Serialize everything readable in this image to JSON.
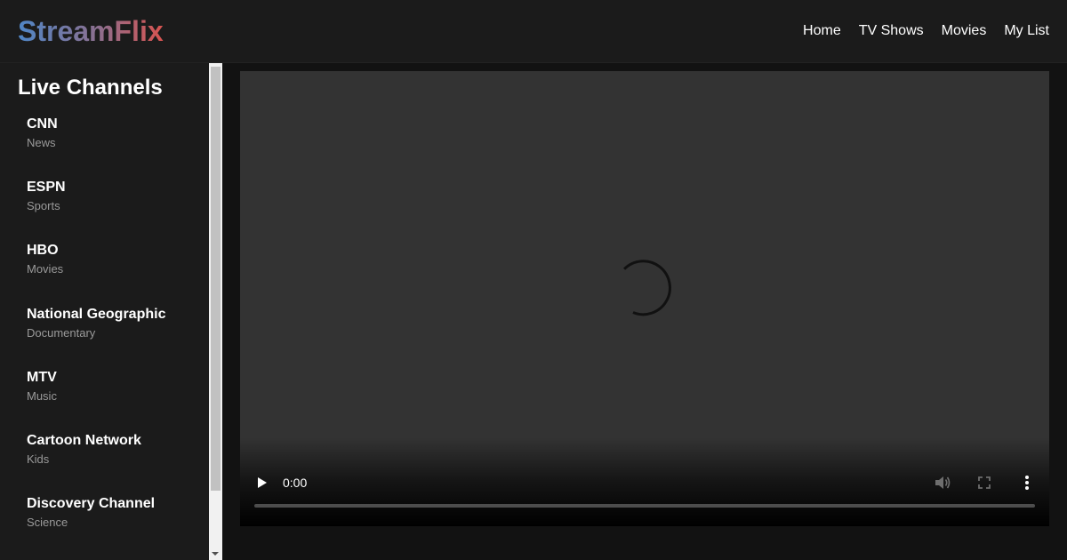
{
  "header": {
    "logo": "StreamFlix",
    "nav": [
      "Home",
      "TV Shows",
      "Movies",
      "My List"
    ]
  },
  "sidebar": {
    "title": "Live Channels",
    "channels": [
      {
        "name": "CNN",
        "genre": "News"
      },
      {
        "name": "ESPN",
        "genre": "Sports"
      },
      {
        "name": "HBO",
        "genre": "Movies"
      },
      {
        "name": "National Geographic",
        "genre": "Documentary"
      },
      {
        "name": "MTV",
        "genre": "Music"
      },
      {
        "name": "Cartoon Network",
        "genre": "Kids"
      },
      {
        "name": "Discovery Channel",
        "genre": "Science"
      }
    ]
  },
  "player": {
    "current_time": "0:00",
    "progress": 0,
    "state": "loading",
    "icons": [
      "play-icon",
      "volume-icon",
      "fullscreen-icon",
      "more-options-icon",
      "loading-spinner"
    ]
  },
  "colors": {
    "logo_gradient": [
      "#4f86c6",
      "#d9534f"
    ],
    "background": "#121212",
    "panel": "#1b1b1b",
    "video_bg": "#333333"
  }
}
